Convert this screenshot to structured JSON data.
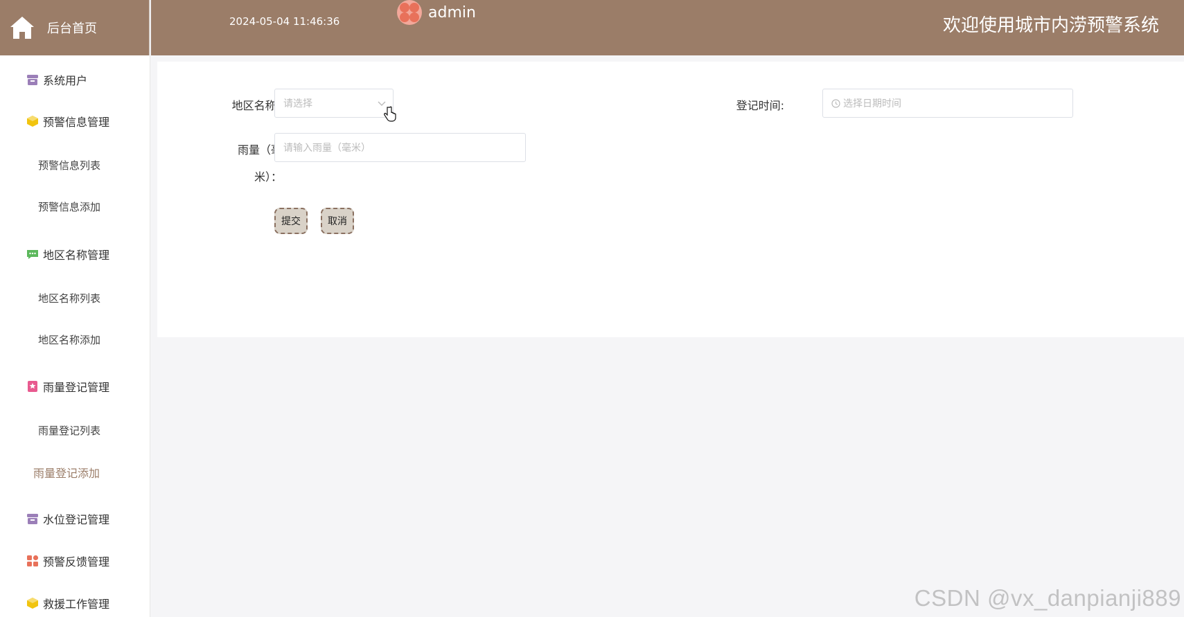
{
  "sidebar": {
    "brand_label": "后台首页",
    "items": [
      {
        "label": "系统用户",
        "icon": "archive-icon",
        "color": "#9b7fb8"
      },
      {
        "label": "预警信息管理",
        "icon": "cube-icon",
        "color": "#f1c40f"
      },
      {
        "label": "预警信息列表"
      },
      {
        "label": "预警信息添加"
      },
      {
        "label": "地区名称管理",
        "icon": "chat-icon",
        "color": "#5cb85c"
      },
      {
        "label": "地区名称列表"
      },
      {
        "label": "地区名称添加"
      },
      {
        "label": "雨量登记管理",
        "icon": "badge-icon",
        "color": "#e85a8f"
      },
      {
        "label": "雨量登记列表"
      },
      {
        "label": "雨量登记添加"
      },
      {
        "label": "水位登记管理",
        "icon": "archive-icon",
        "color": "#9b7fb8"
      },
      {
        "label": "预警反馈管理",
        "icon": "grid-icon",
        "color": "#e8715a"
      },
      {
        "label": "救援工作管理",
        "icon": "cube-icon",
        "color": "#f1c40f"
      }
    ]
  },
  "header": {
    "datetime": "2024-05-04 11:46:36",
    "username": "admin",
    "welcome": "欢迎使用城市内涝预警系统"
  },
  "form": {
    "region_label": "地区名称:",
    "region_placeholder": "请选择",
    "time_label": "登记时间:",
    "time_placeholder": "选择日期时间",
    "rain_label_1": "雨量（毫",
    "rain_label_2": "米）：",
    "rain_placeholder": "请输入雨量（毫米）",
    "submit_label": "提交",
    "cancel_label": "取消"
  },
  "watermark": "CSDN @vx_danpianji889",
  "colors": {
    "header_bg": "#9b7d68",
    "active_menu": "#9b7d68",
    "button_bg": "#d9d2c8"
  }
}
